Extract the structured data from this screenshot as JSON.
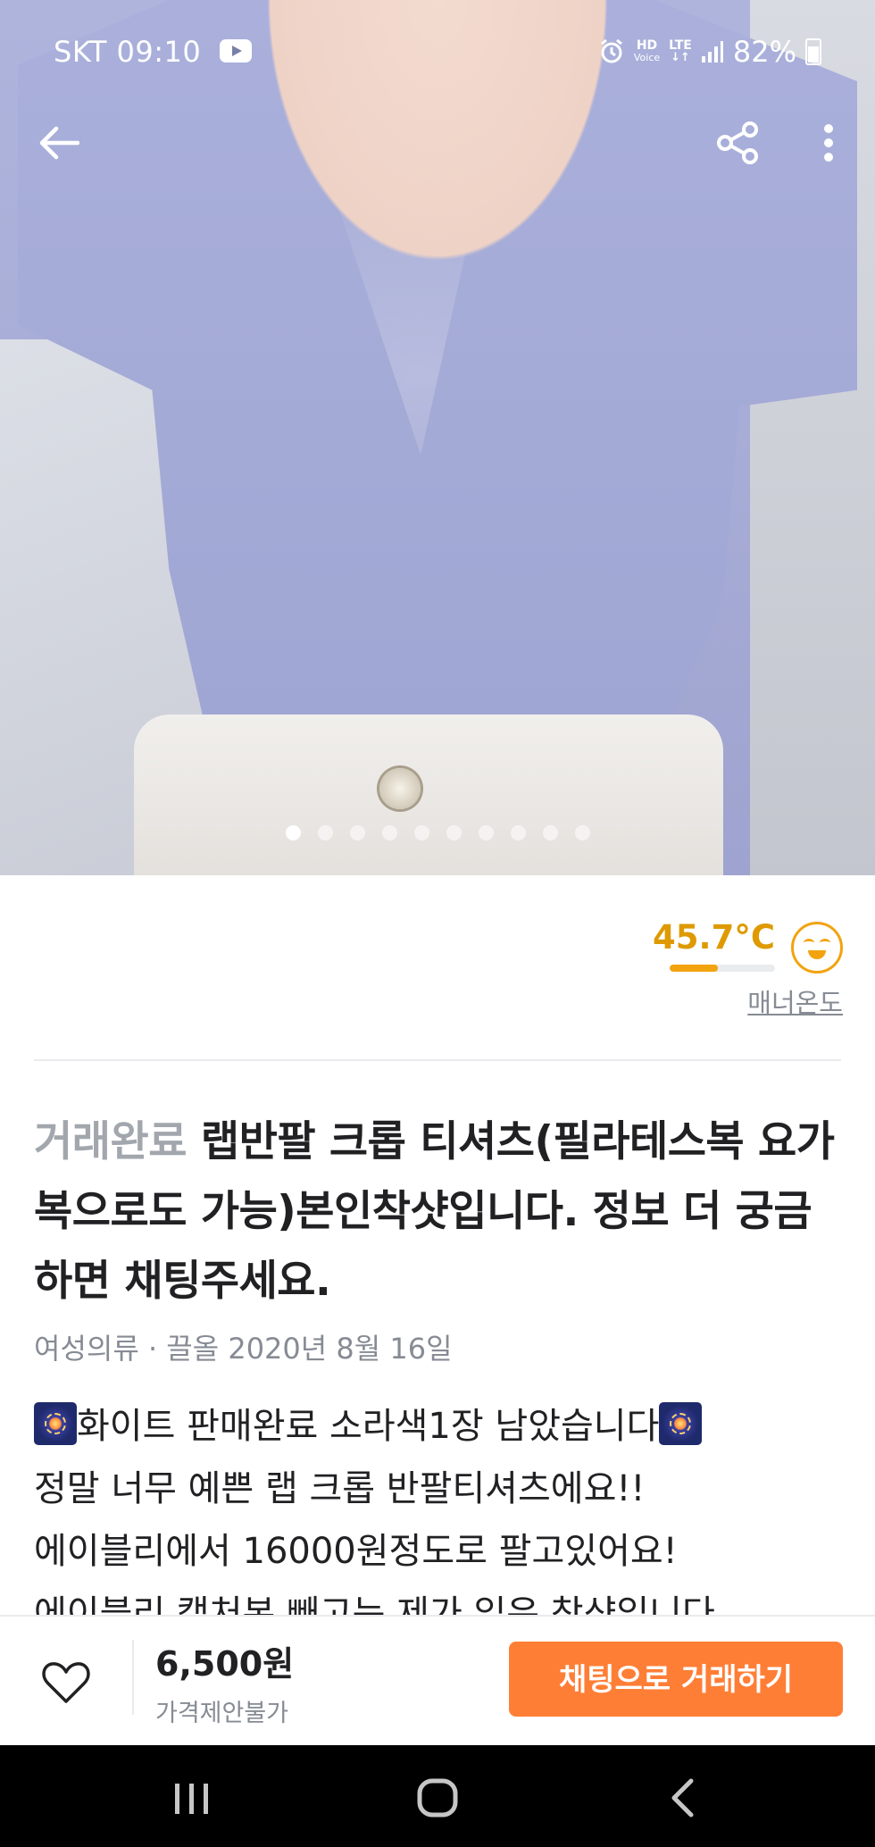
{
  "status_bar": {
    "carrier": "SKT",
    "time": "09:10",
    "hd_label": "HD",
    "voice_label": "Voice",
    "lte_label": "LTE",
    "battery": "82%"
  },
  "photo": {
    "page_count": 10,
    "current_page": 1
  },
  "manner": {
    "temperature": "45.7°C",
    "temperature_value": 45.7,
    "label": "매너온도",
    "accent_color": "#f2a30f"
  },
  "product": {
    "status": "거래완료",
    "title": "랩반팔 크롭 티셔츠(필라테스복 요가복으로도 가능)본인착샷입니다. 정보 더 궁금하면 채팅주세요.",
    "category": "여성의류",
    "separator": "·",
    "date": "끌올 2020년 8월 16일",
    "description_lines": [
      "화이트 판매완료 소라색1장 남았습니다",
      "정말 너무 예쁜 랩 크롭 반팔티셔츠에요!!",
      "에이블리에서 16000원정도로 팔고있어요!",
      "에이블리 캡처본 빼고는 제가 입은 착샷입니다"
    ]
  },
  "action_bar": {
    "price": "6,500원",
    "price_note": "가격제안불가",
    "chat_button": "채팅으로 거래하기",
    "brand_color": "#ff7e36"
  }
}
